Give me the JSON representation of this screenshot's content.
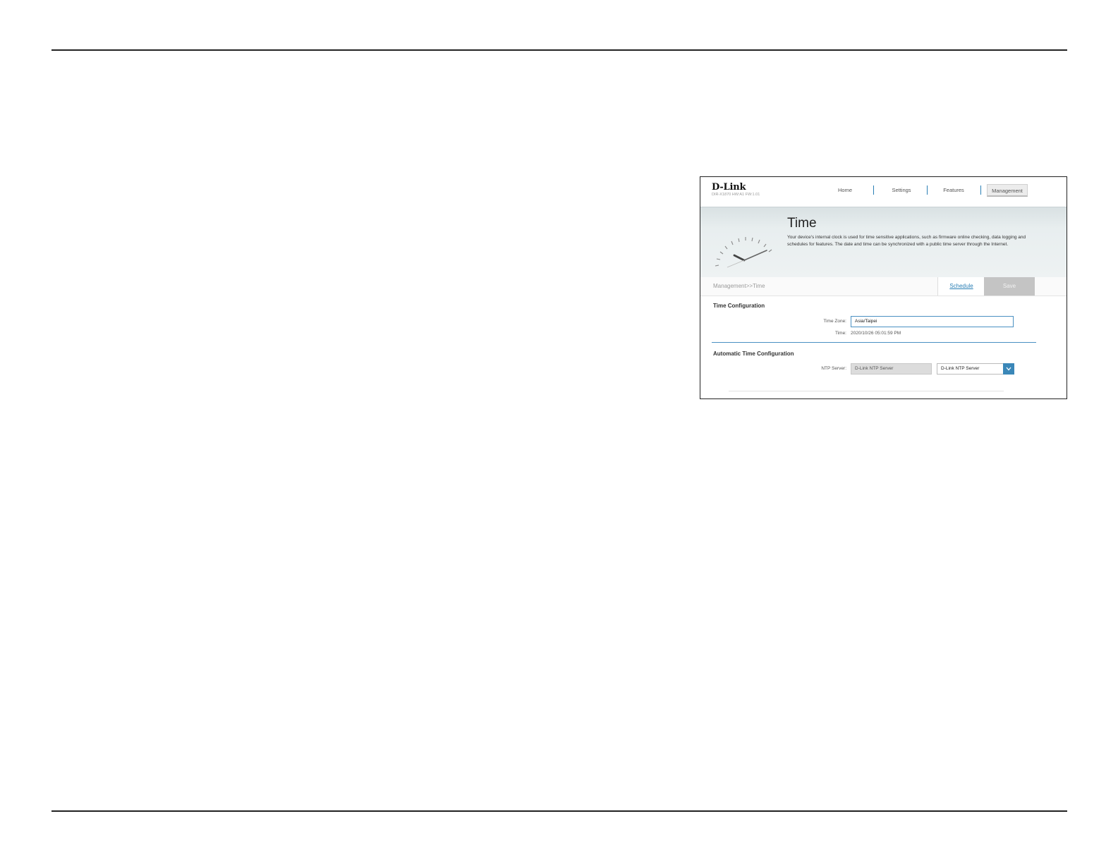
{
  "screenshot": {
    "brand": "D-Link",
    "model": "DIR-X1870 HW:A1 FW:1.01",
    "nav": [
      {
        "label": "Home"
      },
      {
        "label": "Settings"
      },
      {
        "label": "Features"
      },
      {
        "label": "Management",
        "active": true
      }
    ],
    "banner": {
      "title": "Time",
      "description": "Your device's internal clock is used for time sensitive applications, such as firmware online checking, data logging and schedules for features. The date and time can be synchronized with a public time server through the Internet.",
      "icon": "clock-icon"
    },
    "breadcrumb": "Management>>Time",
    "buttons": {
      "schedule": "Schedule",
      "save": "Save"
    },
    "time_config": {
      "title": "Time Configuration",
      "timezone_label": "Time Zone:",
      "timezone_value": "Asia/Taipei",
      "time_label": "Time:",
      "time_value": "2020/10/26 05:01:59 PM"
    },
    "auto_config": {
      "title": "Automatic Time Configuration",
      "ntp_label": "NTP Server:",
      "ntp_field_value": "D-Link NTP Server",
      "ntp_select_value": "D-Link NTP Server"
    }
  },
  "colors": {
    "accent": "#3a87b8",
    "rule": "#222222"
  }
}
